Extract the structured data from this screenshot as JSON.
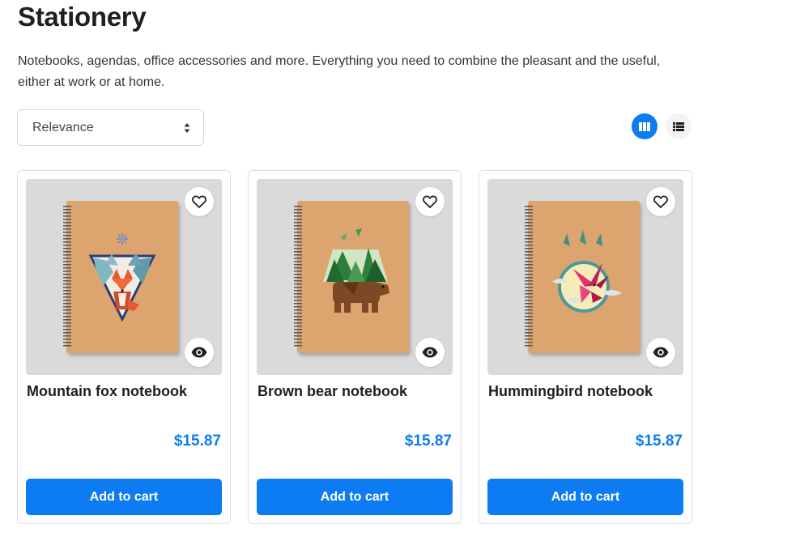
{
  "page": {
    "title": "Stationery",
    "description": "Notebooks, agendas, office accessories and more. Everything you need to combine the pleasant and the useful, either at work or at home."
  },
  "sort": {
    "selected": "Relevance"
  },
  "view_toggle": {
    "active": "grid",
    "icons": [
      "grid-view-icon",
      "list-view-icon"
    ]
  },
  "colors": {
    "accent": "#0d7cf2",
    "image_bg": "#dadada",
    "notebook": "#dca46f"
  },
  "products": [
    {
      "name": "Mountain fox notebook",
      "price": "$15.87",
      "button": "Add to cart",
      "icon": "fox-illustration"
    },
    {
      "name": "Brown bear notebook",
      "price": "$15.87",
      "button": "Add to cart",
      "icon": "bear-illustration"
    },
    {
      "name": "Hummingbird notebook",
      "price": "$15.87",
      "button": "Add to cart",
      "icon": "hummingbird-illustration"
    }
  ]
}
